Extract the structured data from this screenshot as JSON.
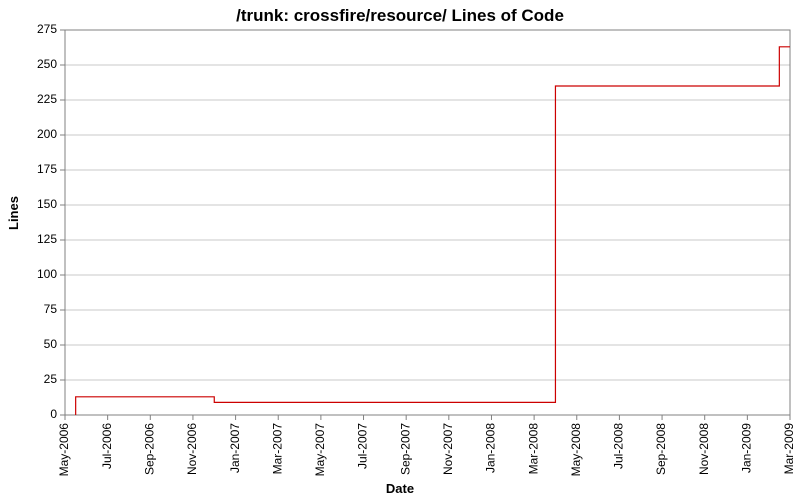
{
  "chart_data": {
    "type": "line",
    "title": "/trunk: crossfire/resource/ Lines of Code",
    "xlabel": "Date",
    "ylabel": "Lines",
    "ylim": [
      0,
      275
    ],
    "yticks": [
      0,
      25,
      50,
      75,
      100,
      125,
      150,
      175,
      200,
      225,
      250,
      275
    ],
    "xticks": [
      "May-2006",
      "Jul-2006",
      "Sep-2006",
      "Nov-2006",
      "Jan-2007",
      "Mar-2007",
      "May-2007",
      "Jul-2007",
      "Sep-2007",
      "Nov-2007",
      "Jan-2008",
      "Mar-2008",
      "May-2008",
      "Jul-2008",
      "Sep-2008",
      "Nov-2008",
      "Jan-2009",
      "Mar-2009"
    ],
    "x_range_months": [
      "May-2006",
      "Mar-2009"
    ],
    "series": [
      {
        "name": "lines-of-code",
        "color": "#cc0000",
        "points": [
          {
            "x": "mid-May-2006",
            "y": 0
          },
          {
            "x": "mid-May-2006",
            "y": 13
          },
          {
            "x": "Dec-2006",
            "y": 13
          },
          {
            "x": "Dec-2006",
            "y": 9
          },
          {
            "x": "Apr-2008",
            "y": 9
          },
          {
            "x": "Apr-2008",
            "y": 235
          },
          {
            "x": "mid-Feb-2009",
            "y": 235
          },
          {
            "x": "mid-Feb-2009",
            "y": 263
          },
          {
            "x": "Mar-2009",
            "y": 263
          }
        ]
      }
    ]
  }
}
